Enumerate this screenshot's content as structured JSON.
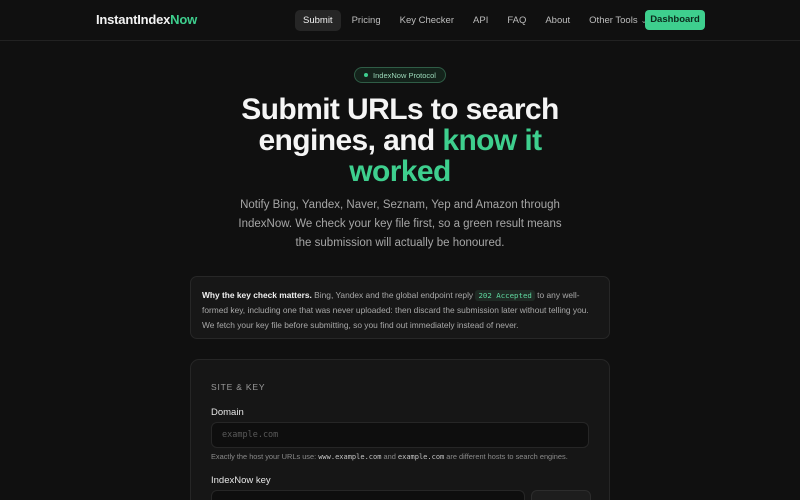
{
  "nav": {
    "logo_main": "InstantIndex",
    "logo_accent": "Now",
    "links": [
      {
        "label": "Submit"
      },
      {
        "label": "Pricing"
      },
      {
        "label": "Key Checker"
      },
      {
        "label": "API"
      },
      {
        "label": "FAQ"
      },
      {
        "label": "About"
      },
      {
        "label": "Other Tools"
      }
    ],
    "dashboard_label": "Dashboard"
  },
  "hero": {
    "pill": "IndexNow Protocol",
    "title_line1": "Submit URLs to search",
    "title_line2a": "engines, and ",
    "title_line2b": "know it",
    "title_line3": "worked",
    "subtitle": "Notify Bing, Yandex, Naver, Seznam, Yep and Amazon through IndexNow. We check your key file first, so a green result means the submission will actually be honoured."
  },
  "callout": {
    "bold": "Why the key check matters.",
    "text_before": " Bing, Yandex and the global endpoint reply ",
    "code": "202 Accepted",
    "text_after": " to any well-formed key, including one that was never uploaded: then discard the submission later without telling you. We fetch your key file before submitting, so you find out immediately instead of never."
  },
  "form": {
    "section_title": "SITE & KEY",
    "domain_label": "Domain",
    "domain_placeholder": "example.com",
    "domain_value": "",
    "hint_before": "Exactly the host your URLs use: ",
    "hint_code1": "www.example.com",
    "hint_middle": " and ",
    "hint_code2": "example.com",
    "hint_after": " are different hosts to search engines.",
    "key_label": "IndexNow key"
  },
  "colors": {
    "accent": "#3ecf8e",
    "background": "#101010"
  }
}
